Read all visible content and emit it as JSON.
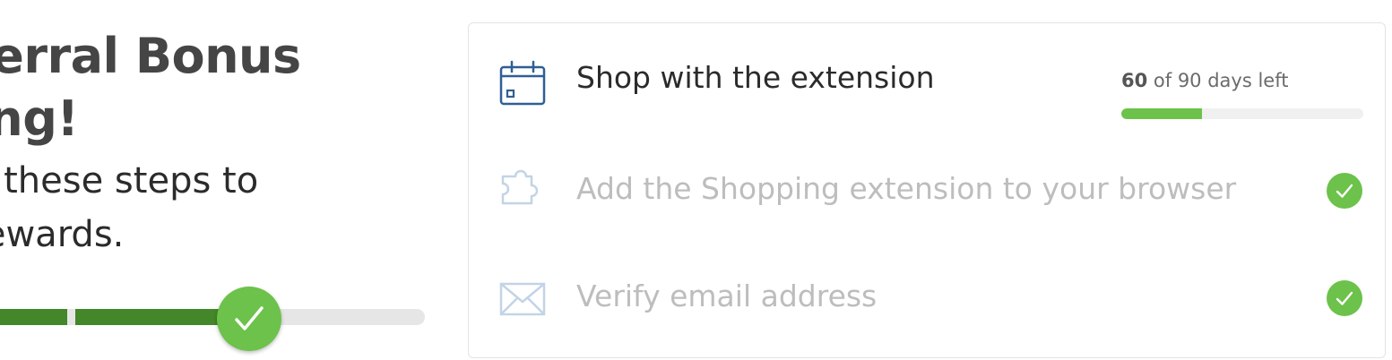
{
  "hero": {
    "headline_line1": "Referral Bonus",
    "headline_line2": "aiting!",
    "subline_line1": "plete these steps to",
    "subline_line2": "em rewards."
  },
  "overall_progress": {
    "completed_steps": 2,
    "total_steps": 3,
    "colors": {
      "done": "#44862a",
      "track": "#e6e6e6",
      "check": "#6cc24a"
    }
  },
  "steps": [
    {
      "label": "Shop with the extension",
      "icon": "calendar-icon",
      "status": "active",
      "days_used": "60",
      "days_text": " of 90 days left",
      "days_total": 90,
      "progress_fraction": 0.333
    },
    {
      "label": "Add the Shopping extension to your browser",
      "icon": "puzzle-icon",
      "status": "done"
    },
    {
      "label": "Verify email address",
      "icon": "envelope-icon",
      "status": "done"
    }
  ],
  "colors": {
    "accent_green": "#6cc24a",
    "icon_active_blue": "#2e5f94",
    "icon_done_blue": "#c2d4e6",
    "text_dark": "#2b2b2b",
    "text_muted": "#bdbdbd"
  }
}
